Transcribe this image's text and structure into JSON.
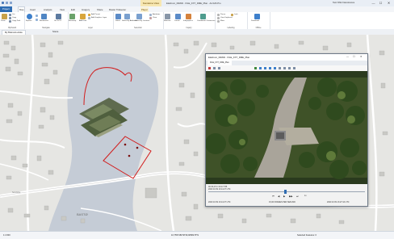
{
  "titlebar": {
    "window_title": "Elektrum_DRAW · FILE_FXT_DME_Plan · ArcGIS Pro",
    "context_tab": "Standalone Video",
    "user": "Tanz Dffer Nanoknoone",
    "minimize": "—",
    "maximize": "☐",
    "close": "✕"
  },
  "ribbon_tabs": [
    {
      "label": "Project",
      "style": "file"
    },
    {
      "label": "Map",
      "style": "active"
    },
    {
      "label": "Insert",
      "style": ""
    },
    {
      "label": "Analysis",
      "style": ""
    },
    {
      "label": "View",
      "style": ""
    },
    {
      "label": "Edit",
      "style": ""
    },
    {
      "label": "Imagery",
      "style": ""
    },
    {
      "label": "Share",
      "style": ""
    },
    {
      "label": "Raster Tidsserier",
      "style": ""
    },
    {
      "label": "Player",
      "style": "ctx"
    }
  ],
  "ribbon": {
    "clipboard": {
      "label": "Clipboard",
      "paste": "Paste",
      "cut": "Cut",
      "copy": "Copy",
      "copy_path": "Copy Path"
    },
    "navigate": {
      "label": "Navigate",
      "explore": "Explore",
      "bookmarks": "Bookmarks",
      "go_to_xy": "Go To XY"
    },
    "layer": {
      "label": "Layer",
      "basemap": "Basemap",
      "add_data": "Add Data",
      "add_preset": "Add Preset",
      "add_graphics": "Add Graphics Layer"
    },
    "selection": {
      "label": "Selection",
      "select": "Select",
      "by_attributes": "Select By Attributes",
      "by_location": "Select By Location",
      "attributes": "Attributes",
      "clear": "Clear"
    },
    "inquiry": {
      "label": "Inquiry",
      "measure": "Measure",
      "locate": "Locate",
      "infographics": "Infographics",
      "coordinate": "Coordinate Conversion"
    },
    "labeling": {
      "label": "Labeling",
      "pause": "Pause",
      "lock": "Lock",
      "view_unplaced": "View Unplaced",
      "more": "More"
    },
    "offline": {
      "label": "Offline",
      "download": "Download"
    }
  },
  "view_tabs": [
    {
      "label": "My Bokmerk-ebula",
      "active": true
    },
    {
      "label": "Scene",
      "active": false
    }
  ],
  "map": {
    "place_label": "BASTØ",
    "street_labels": [
      "Fjordveien",
      "Sandvika"
    ]
  },
  "player": {
    "title": "Elektrum_DRAW · FILE_FXT_DME_Plan",
    "tab": "FILE_FXT_DME_Plan",
    "frame_time": "00:15,274 / 00:17:765",
    "capture_date": "2020 10 09 13:14:27 UTC",
    "clock_left": "2020 10 09 13:14:27 UTC",
    "clock_right": "2020 10 09 13:27:44 UTC",
    "fps": "15,00 FRAMES PER SEKUND",
    "rate": "1x"
  },
  "status": {
    "scale": "1:4 600",
    "coordinates": "10,7557483°Ø 59,9058176°N",
    "selected": "Selected Features: 0"
  },
  "colors": {
    "accent": "#2f6db3",
    "flight_path": "#d21c1c",
    "water": "#c7cdd6",
    "buildings": "#c8c8c4"
  }
}
